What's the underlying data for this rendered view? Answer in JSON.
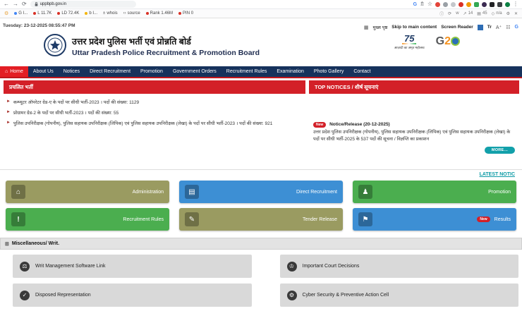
{
  "browser": {
    "url": "uppbpb.gov.in",
    "seoquake": {
      "items": [
        "G I...",
        "L 11.7K",
        "LD 72.4K",
        "b I...",
        "whois",
        "source",
        "Rank 1.46M",
        "PIN 0"
      ],
      "links_count": "14",
      "index_count": "45",
      "na": "n/a"
    }
  },
  "header": {
    "datetime": "Tuesday: 23-12-2025 08:55:47 PM",
    "utility": {
      "home": "मुख्य पृष्ठ",
      "skip": "Skip to main content",
      "screen_reader": "Screen Reader",
      "translate": "Tr",
      "google": "G"
    },
    "title_hi": "उत्तर प्रदेश पुलिस भर्ती एवं प्रोन्नति बोर्ड",
    "title_en": "Uttar Pradesh Police Recruitment & Promotion Board",
    "logos": {
      "azadi_number": "75",
      "azadi_caption": "आज़ादी का अमृत महोत्सव",
      "g20_g": "G",
      "g20_2": "2"
    }
  },
  "nav": {
    "items": [
      {
        "label": "Home",
        "active": true
      },
      {
        "label": "About Us"
      },
      {
        "label": "Notices"
      },
      {
        "label": "Direct Recruitment"
      },
      {
        "label": "Promotion"
      },
      {
        "label": "Government Orders"
      },
      {
        "label": "Recruitment Rules"
      },
      {
        "label": "Examination"
      },
      {
        "label": "Photo Gallery"
      },
      {
        "label": "Contact"
      }
    ]
  },
  "current_recruitment": {
    "header": "प्रचलित भर्ती",
    "items": [
      "कम्प्यूटर ऑपरेटर ग्रेड-ए के पदों पर सीधी भर्ती-2023 । पदों की संख्या: 1129",
      "प्रोग्रामर ग्रेड-2 के पदों पर सीधी भर्ती-2023 । पदों की संख्या: 55",
      "पुलिस उपनिरीक्षक (गोपनीय), पुलिस सहायक उपनिरीक्षक (लिपिक) एवं पुलिस सहायक उपनिरीक्षक (लेखा) के पदों पर सीधी भर्ती-2023 । पदों की संख्या: 921"
    ]
  },
  "top_notices": {
    "header": "TOP NOTICES / शीर्ष सूचनाएं",
    "badge": "New",
    "title": "Notice/Release (20-12-2025)",
    "text": "उत्तर प्रदेश पुलिस उपनिरीक्षक (गोपनीय), पुलिस सहायक उपनिरीक्षक (लिपिक) एवं पुलिस सहायक उपनिरीक्षक (लेखा) के पदों पर सीधी भर्ती-2025 के 537 पदों की सूचना / विज्ञप्ति का प्रकाशन",
    "more": "MORE..."
  },
  "latest_notice_link": "LATEST NOTIC",
  "tiles": [
    {
      "label": "Administration"
    },
    {
      "label": "Direct Recruitment"
    },
    {
      "label": "Promotion"
    },
    {
      "label": "Recruitment Rules"
    },
    {
      "label": "Tender Release"
    },
    {
      "label": "Results",
      "badge": "New"
    }
  ],
  "misc": {
    "header": "Miscellaneous/ Writ.",
    "cards": [
      {
        "label": "Writ Management Software Link"
      },
      {
        "label": "Important Court Decisions"
      },
      {
        "label": "Disposed Representation"
      },
      {
        "label": "Cyber Security & Preventive Action Cell"
      }
    ]
  },
  "colors": {
    "accent_red": "#d32028",
    "navy": "#16325c",
    "teal": "#12a0aa",
    "olive": "#9a9b61",
    "blue": "#3d8fd4",
    "green": "#4bae4f"
  }
}
